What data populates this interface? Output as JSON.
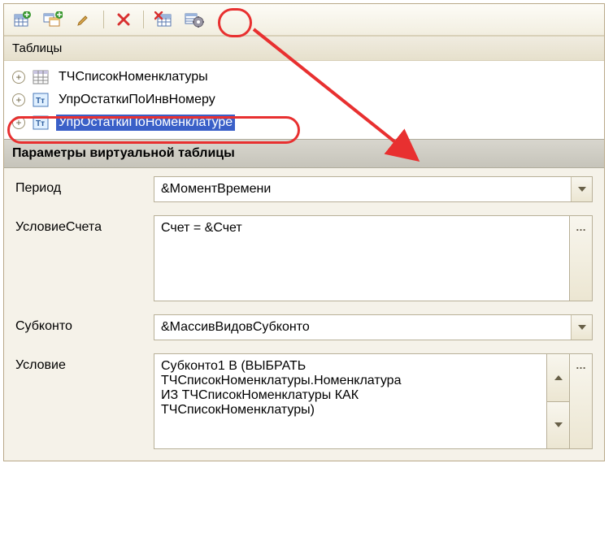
{
  "toolbar": {
    "add_table": "add-table",
    "add_nested": "add-nested-table",
    "edit": "edit",
    "delete": "delete",
    "replace_table": "replace-table",
    "settings": "virtual-table-params"
  },
  "sections": {
    "tables_title": "Таблицы",
    "params_title": "Параметры виртуальной таблицы"
  },
  "tree": {
    "items": [
      {
        "label": "ТЧСписокНоменклатуры",
        "icon": "table-icon",
        "selected": false
      },
      {
        "label": "УпрОстаткиПоИнвНомеру",
        "icon": "virtual-table-icon",
        "selected": false
      },
      {
        "label": "УпрОстаткиПоНоменклатуре",
        "icon": "virtual-table-icon",
        "selected": true
      }
    ]
  },
  "params": {
    "period_label": "Период",
    "period_value": "&МоментВремени",
    "account_cond_label": "УсловиеСчета",
    "account_cond_value": "Счет = &Счет",
    "subkonto_label": "Субконто",
    "subkonto_value": "&МассивВидовСубконто",
    "condition_label": "Условие",
    "condition_value": "Субконто1 В (ВЫБРАТЬ\nТЧСписокНоменклатуры.Номенклатура\nИЗ ТЧСписокНоменклатуры КАК\nТЧСписокНоменклатуры)"
  }
}
